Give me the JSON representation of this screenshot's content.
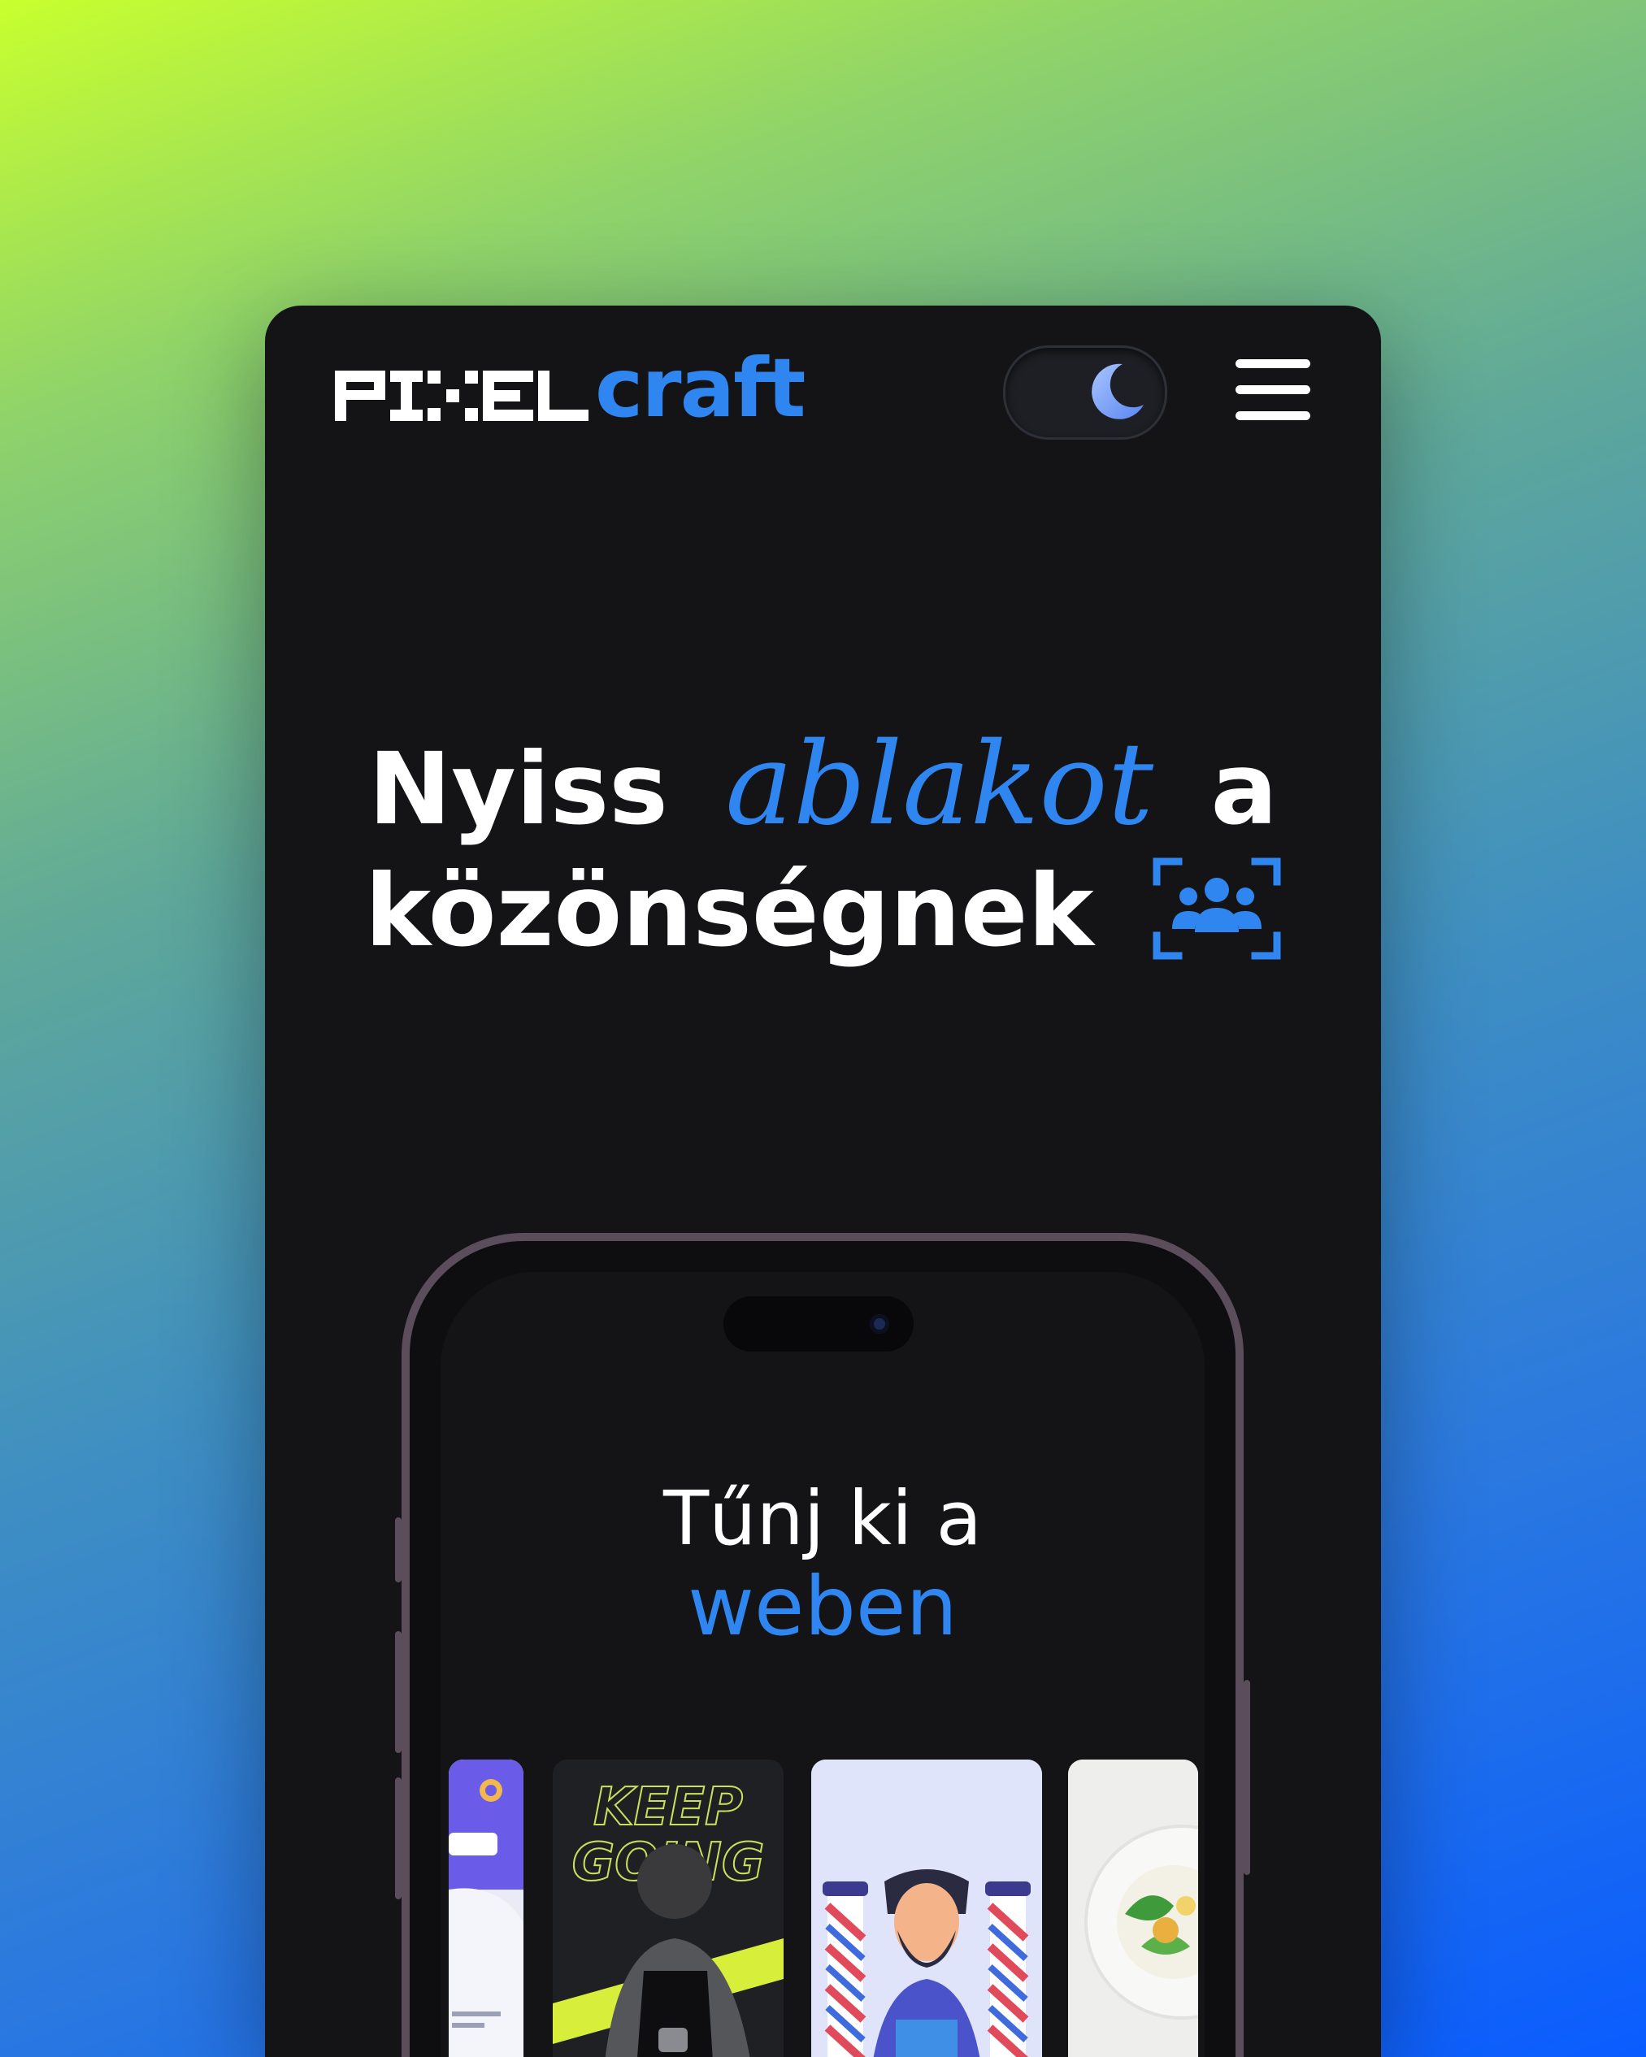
{
  "brand": {
    "logo_pixel_text": "PIXEL",
    "logo_craft_text": "craft",
    "accent_color": "#2f86f0"
  },
  "header": {
    "theme_toggle_icon": "moon-icon",
    "menu_icon": "hamburger-icon"
  },
  "hero": {
    "line1_start": "Nyiss",
    "line1_accent": "ablakot",
    "line1_end": "a",
    "line2": "közönségnek",
    "line2_icon": "audience-icon"
  },
  "phone": {
    "title_line1": "Tűnj ki a",
    "title_line2": "weben",
    "cards": [
      {
        "name": "app-preview-card"
      },
      {
        "name": "fitness-card",
        "heading": "KEEP GOING"
      },
      {
        "name": "barber-card"
      },
      {
        "name": "food-card"
      }
    ]
  }
}
